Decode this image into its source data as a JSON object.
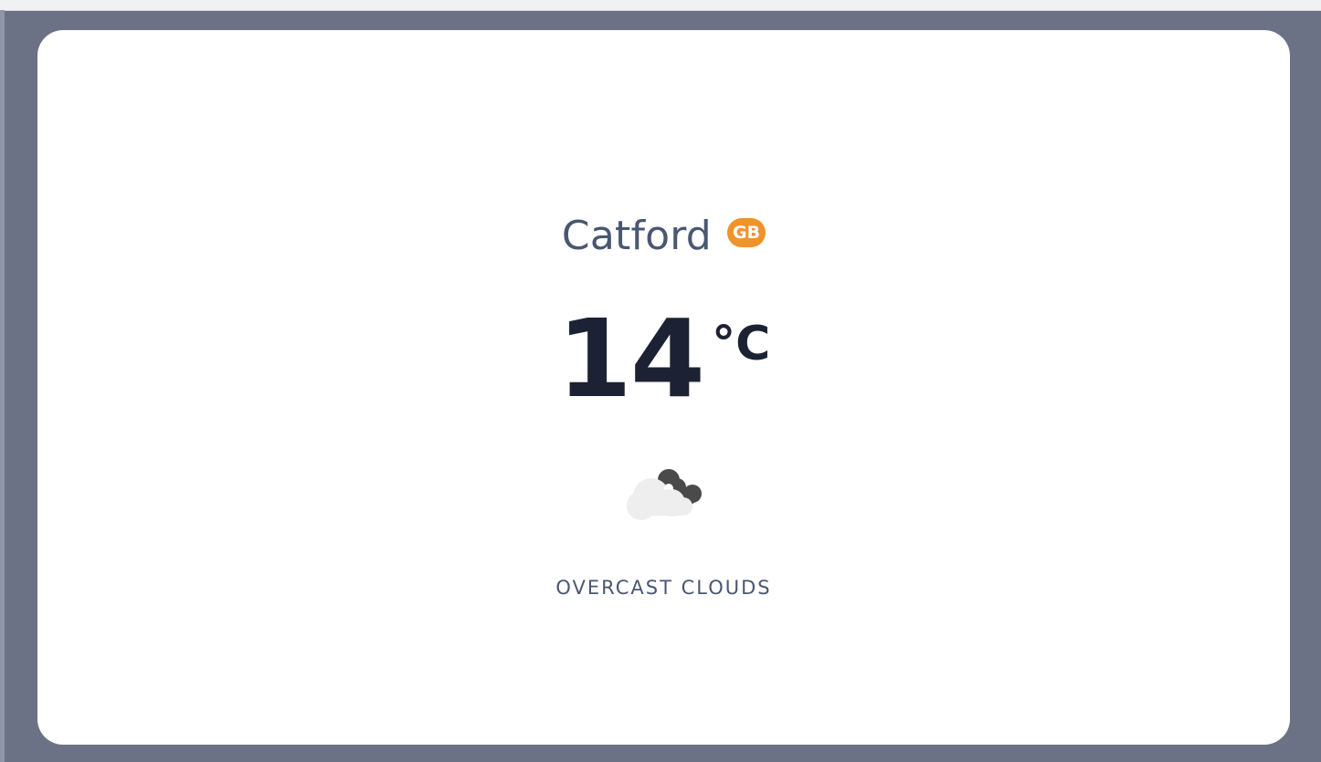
{
  "weather": {
    "city": "Catford",
    "country_code": "GB",
    "temperature": "14",
    "unit": "°C",
    "condition": "OVERCAST CLOUDS",
    "icon": "overcast-clouds-icon"
  },
  "colors": {
    "background": "#6b7285",
    "card": "#ffffff",
    "city_text": "#4a5771",
    "badge": "#f0932b",
    "temperature_text": "#1c2234",
    "light_cloud": "#eeeeee",
    "dark_cloud": "#4a4a4a"
  }
}
